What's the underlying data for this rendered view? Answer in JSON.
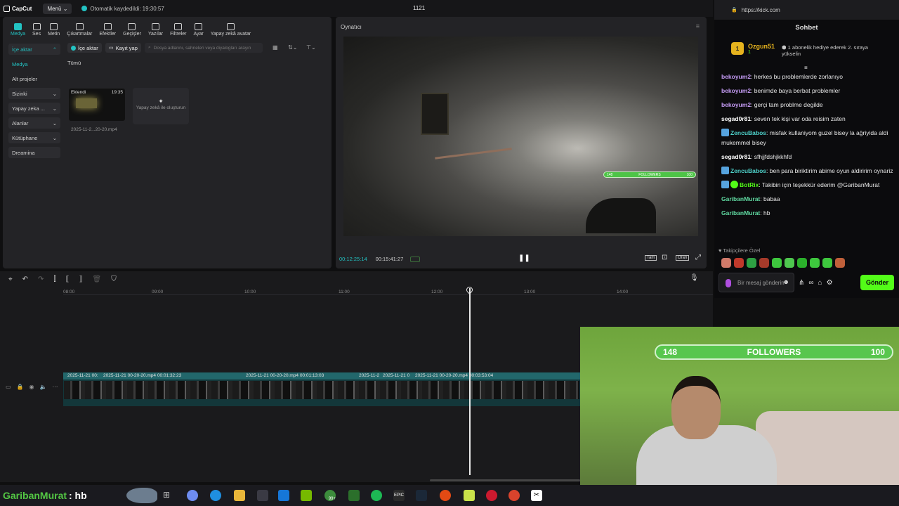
{
  "app": {
    "name": "CapCut",
    "menu_label": "Menü",
    "autosave_text": "Otomatik kaydedildi: 19:30:57",
    "project_title": "1121"
  },
  "toolbar": {
    "items": [
      {
        "label": "Medya",
        "icon": "media-icon",
        "active": true
      },
      {
        "label": "Ses",
        "icon": "audio-icon"
      },
      {
        "label": "Metin",
        "icon": "text-icon"
      },
      {
        "label": "Çıkartmalar",
        "icon": "sticker-icon"
      },
      {
        "label": "Efektler",
        "icon": "effects-icon"
      },
      {
        "label": "Geçişler",
        "icon": "transitions-icon"
      },
      {
        "label": "Yazılar",
        "icon": "captions-icon"
      },
      {
        "label": "Filtreler",
        "icon": "filters-icon"
      },
      {
        "label": "Ayar",
        "icon": "adjust-icon"
      },
      {
        "label": "Yapay zekâ avatar",
        "icon": "ai-avatar-icon"
      }
    ]
  },
  "sidebar": {
    "items": [
      {
        "label": "İçe aktar"
      },
      {
        "label": "Medya"
      },
      {
        "label": "Alt projeler"
      },
      {
        "label": "Sizinki"
      },
      {
        "label": "Yapay zeka ..."
      },
      {
        "label": "Alanlar"
      },
      {
        "label": "Kütüphane"
      },
      {
        "label": "Dreamina"
      }
    ]
  },
  "media": {
    "import_button": "İçe aktar",
    "record_button": "Kayıt yap",
    "search_placeholder": "Dosya adlarını, sahneleri veya diyalogları arayın",
    "filter_all": "Tümü",
    "clip_badge": "Eklendi",
    "clip_duration": "19:35",
    "clip_name": "2025-11-2...20-20.mp4",
    "ai_card_text": "Yapay zekâ ile oluşturun"
  },
  "player": {
    "title": "Oynatıcı",
    "current_time": "00:12:25:14",
    "total_time": "00:15:41:27",
    "followers_bar": {
      "left": "148",
      "label": "FOLLOWERS",
      "right": "100"
    },
    "btn_full": "Tam",
    "btn_ratio": "Oran"
  },
  "timeline": {
    "ruler_ticks": [
      "08:00",
      "09:00",
      "10:00",
      "11:00",
      "12:00",
      "13:00",
      "14:00"
    ],
    "clip_labels": [
      "2025-11-21 00:",
      "2025-11-21 00-20-20.mp4   00:01:32:23",
      "2025-11-21 00-20-20.mp4   00:01:13:03",
      "2025-11-2",
      "2025-11-21 0",
      "2025-11-21 00-20-20.mp4   00:03:53:04"
    ]
  },
  "chat": {
    "url": "https://kick.com",
    "title": "Sohbet",
    "top_gifter": {
      "rank": "1",
      "name": "Ozgun51",
      "count": "1",
      "message": "1 abonelik hediye ederek 2. sıraya yükselin"
    },
    "messages": [
      {
        "user": "bekoyum2",
        "text": "herkes bu problemlerde zorlanıyo",
        "color": "#c49bf4",
        "badges": []
      },
      {
        "user": "bekoyum2",
        "text": "benimde baya berbat problemler",
        "color": "#c49bf4",
        "badges": []
      },
      {
        "user": "bekoyum2",
        "text": "gerçi tam problme degilde",
        "color": "#c49bf4",
        "badges": []
      },
      {
        "user": "segad0r81",
        "text": "seven tek kişi var oda reisim zaten",
        "color": "#ffffff",
        "badges": []
      },
      {
        "user": "ZencuBabos",
        "text": "misfak kullaniyom guzel bisey la ağriyida aldi mukemmel bisey",
        "color": "#4ed0c9",
        "badges": [
          "b"
        ]
      },
      {
        "user": "segad0r81",
        "text": "sfhjjfdshjkkhfd",
        "color": "#ffffff",
        "badges": []
      },
      {
        "user": "ZencuBabos",
        "text": "ben para biriktirim abime oyun aldiririm oynariz",
        "color": "#4ed0c9",
        "badges": [
          "b"
        ]
      },
      {
        "user": "BotRix",
        "text": "Takibin için teşekkür ederim @GaribanMurat",
        "color": "#53fc18",
        "badges": [
          "b",
          "g"
        ]
      },
      {
        "user": "GaribanMurat",
        "text": "babaa",
        "color": "#5fd8a0",
        "badges": []
      },
      {
        "user": "GaribanMurat",
        "text": "hb",
        "color": "#5fd8a0",
        "badges": []
      }
    ],
    "emote_label": "Takipçilere Özel",
    "input_placeholder": "Bir mesaj gönderin",
    "send_label": "Gönder"
  },
  "webcam": {
    "followers_left": "148",
    "followers_label": "FOLLOWERS",
    "followers_right": "100"
  },
  "overlay": {
    "user": "GaribanMurat",
    "text": ": hb"
  },
  "taskbar": {
    "badge": "99+"
  }
}
